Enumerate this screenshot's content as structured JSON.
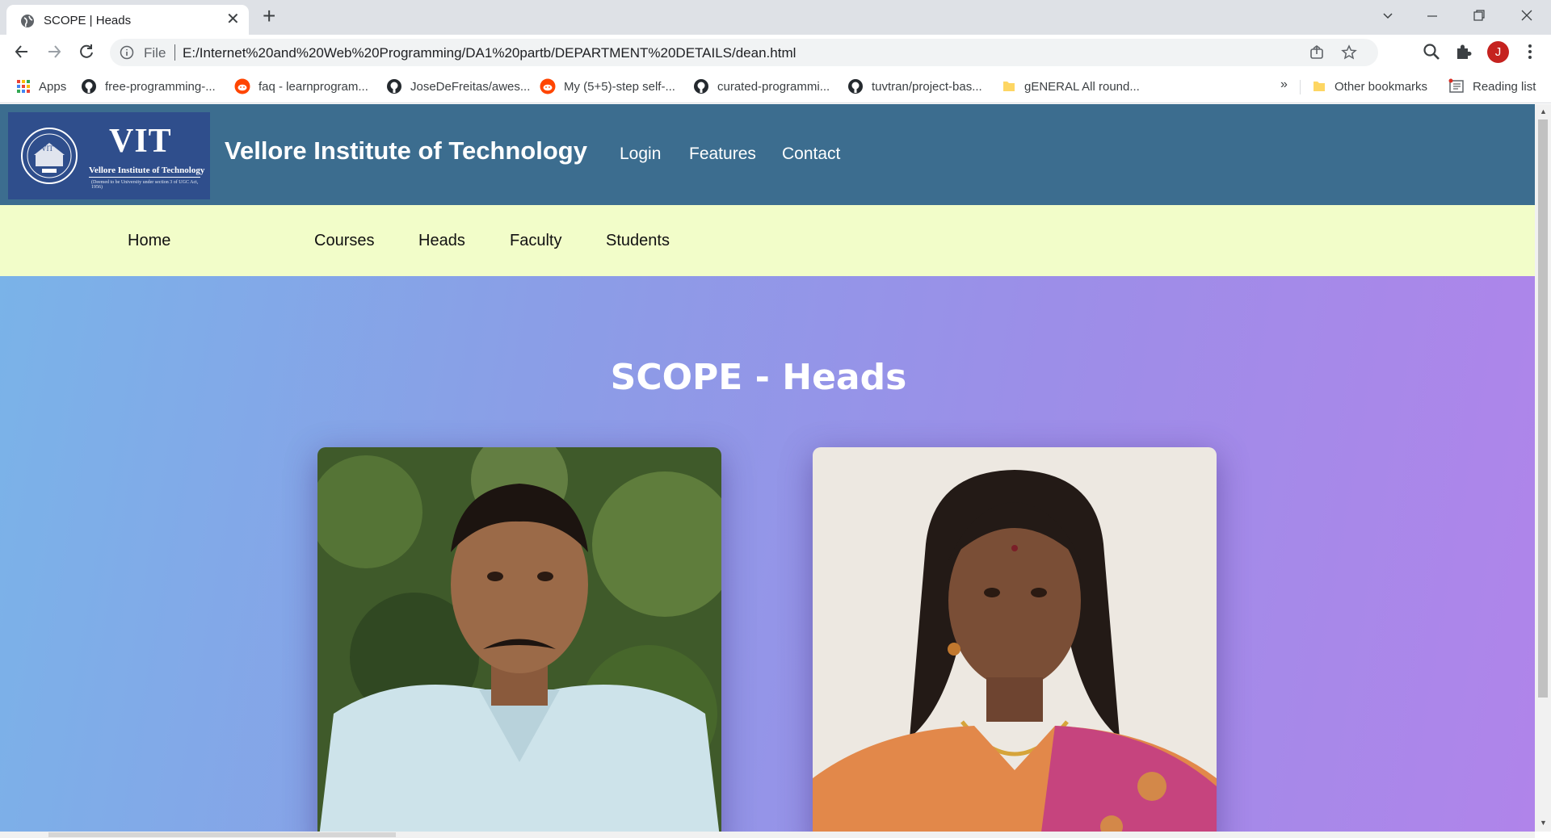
{
  "browser": {
    "tab_title": "SCOPE | Heads",
    "omnibox_scheme": "File",
    "url": "E:/Internet%20and%20Web%20Programming/DA1%20partb/DEPARTMENT%20DETAILS/dean.html",
    "profile_initial": "J",
    "bookmarks": [
      {
        "label": "Apps",
        "icon": "apps-grid-icon"
      },
      {
        "label": "free-programming-...",
        "icon": "github-icon"
      },
      {
        "label": "faq - learnprogram...",
        "icon": "reddit-icon"
      },
      {
        "label": "JoseDeFreitas/awes...",
        "icon": "github-icon"
      },
      {
        "label": "My (5+5)-step self-...",
        "icon": "reddit-icon"
      },
      {
        "label": "curated-programmi...",
        "icon": "github-icon"
      },
      {
        "label": "tuvtran/project-bas...",
        "icon": "github-icon"
      },
      {
        "label": "gENERAL All round...",
        "icon": "folder-icon"
      }
    ],
    "bookmarks_overflow": "»",
    "other_bookmarks": "Other bookmarks",
    "reading_list": "Reading list"
  },
  "site": {
    "logo_text": "VIT",
    "logo_subtitle": "Vellore Institute of Technology",
    "logo_tagline": "(Deemed to be University under section 3 of UGC Act, 1956)",
    "title": "Vellore Institute of Technology",
    "top_nav": [
      "Login",
      "Features",
      "Contact"
    ],
    "sub_nav": [
      "Home",
      "Courses",
      "Heads",
      "Faculty",
      "Students"
    ],
    "heading": "SCOPE - Heads",
    "colors": {
      "header": "#3c6d8f",
      "subnav": "#f2fdc9",
      "gradient_start": "#7ab3e8",
      "gradient_end": "#b084ea"
    }
  }
}
